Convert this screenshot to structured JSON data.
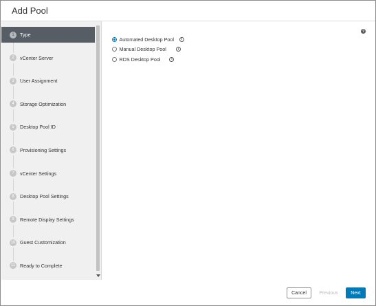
{
  "dialog": {
    "title": "Add Pool"
  },
  "wizard": {
    "steps": [
      {
        "num": "1",
        "label": "Type"
      },
      {
        "num": "2",
        "label": "vCenter Server"
      },
      {
        "num": "3",
        "label": "User Assignment"
      },
      {
        "num": "4",
        "label": "Storage Optimization"
      },
      {
        "num": "5",
        "label": "Desktop Pool ID"
      },
      {
        "num": "6",
        "label": "Provisioning Settings"
      },
      {
        "num": "7",
        "label": "vCenter Settings"
      },
      {
        "num": "8",
        "label": "Desktop Pool Settings"
      },
      {
        "num": "9",
        "label": "Remote Display Settings"
      },
      {
        "num": "10",
        "label": "Guest Customization"
      },
      {
        "num": "11",
        "label": "Ready to Complete"
      }
    ],
    "active_step": "1"
  },
  "pool_type": {
    "options": [
      {
        "label": "Automated Desktop Pool",
        "selected": true
      },
      {
        "label": "Manual Desktop Pool",
        "selected": false
      },
      {
        "label": "RDS Desktop Pool",
        "selected": false
      }
    ],
    "info_icon": "i",
    "help_icon": "?"
  },
  "footer": {
    "cancel_label": "Cancel",
    "previous_label": "Previous",
    "next_label": "Next"
  },
  "colors": {
    "accent": "#0079b8",
    "active_step_bg": "#565d64",
    "sidebar_bg": "#f0f0f0"
  }
}
